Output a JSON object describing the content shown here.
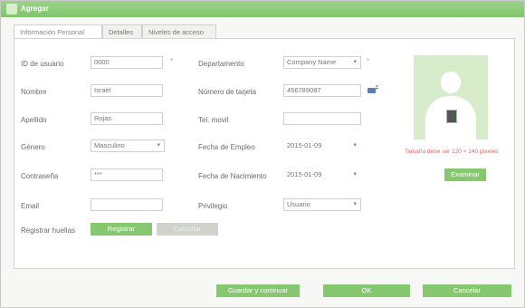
{
  "window": {
    "title": "Agregar"
  },
  "tabs": [
    {
      "label": "Información Personal"
    },
    {
      "label": "Detalles"
    },
    {
      "label": "Niveles de acceso"
    }
  ],
  "form": {
    "user_id": {
      "label": "ID de usuario",
      "value": "0000"
    },
    "first_name": {
      "label": "Nombre",
      "value": "Israel"
    },
    "last_name": {
      "label": "Apellido",
      "value": "Rojas"
    },
    "gender": {
      "label": "Género",
      "value": "Masculino"
    },
    "password": {
      "label": "Contraseña",
      "value": "***"
    },
    "email": {
      "label": "Email",
      "value": ""
    },
    "fingerprint": {
      "label": "Registrar huellas",
      "register_label": "Registrar",
      "delete_label": "Cancelar"
    },
    "department": {
      "label": "Departamento",
      "value": "Company Name"
    },
    "card_number": {
      "label": "Número de tarjeta",
      "value": "456789087"
    },
    "mobile": {
      "label": "Tel. movil",
      "value": ""
    },
    "hire_date": {
      "label": "Fecha de Empleo",
      "value": "2015-01-09"
    },
    "birth_date": {
      "label": "Fecha de Nacimiento",
      "value": "2015-01-09"
    },
    "profile": {
      "label": "Privilegio",
      "value": "Usuario"
    },
    "required_mark": "*"
  },
  "photo": {
    "hint": "Tamaño debe ser 120 × 140 píxeles",
    "browse_label": "Examinar"
  },
  "footer": {
    "save_continue_label": "Guardar y continuar",
    "ok_label": "OK",
    "cancel_label": "Cancelar"
  },
  "colors": {
    "accent": "#86c870",
    "titlebar": "#8ccb78",
    "hint": "#d86a6a"
  },
  "icons": {
    "window": "app-icon",
    "card": "card-reader-icon",
    "dropdown": "chevron-down-icon"
  }
}
